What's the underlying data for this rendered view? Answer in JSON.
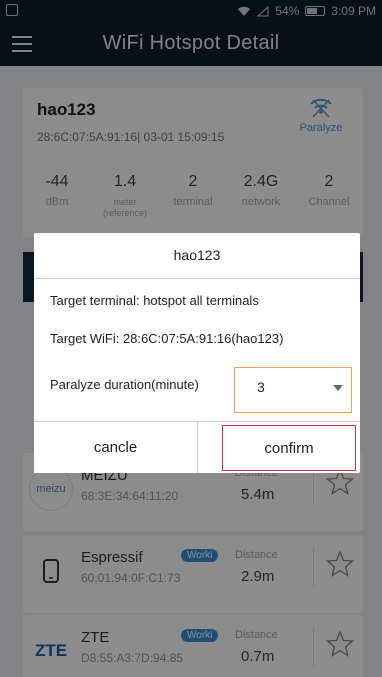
{
  "status_bar": {
    "battery": "54%",
    "time": "3:09 PM"
  },
  "app_bar": {
    "title": "WiFi Hotspot Detail"
  },
  "hotspot": {
    "ssid": "hao123",
    "meta": "28:6C:07:5A:91:16| 03-01 15:09:15",
    "paralyze_label": "Paralyze",
    "stats": [
      {
        "value": "-44",
        "unit": "dBm"
      },
      {
        "value": "1.4",
        "unit": "meter (reference)"
      },
      {
        "value": "2",
        "unit": "terminal"
      },
      {
        "value": "2.4G",
        "unit": "network"
      },
      {
        "value": "2",
        "unit": "Channel"
      }
    ]
  },
  "devices": [
    {
      "brand": "meizu",
      "name": "MEIZU",
      "mac": "68:3E:34:64:11:20",
      "badge": "",
      "distance_label": "Distance",
      "distance": "5.4m"
    },
    {
      "brand": "phone",
      "name": "Espressif",
      "mac": "60:01:94:0F:C1:73",
      "badge": "Worki",
      "distance_label": "Distance",
      "distance": "2.9m"
    },
    {
      "brand": "ZTE",
      "name": "ZTE",
      "mac": "D8:55:A3:7D:94:85",
      "badge": "Worki",
      "distance_label": "Distance",
      "distance": "0.7m"
    }
  ],
  "dialog": {
    "title": "hao123",
    "target_terminal": "Target terminal: hotspot all terminals",
    "target_wifi": "Target WiFi:  28:6C:07:5A:91:16(hao123)",
    "duration_label": "Paralyze duration(minute)",
    "duration_value": "3",
    "cancel_label": "cancle",
    "confirm_label": "confirm"
  },
  "colors": {
    "header_bg": "#0d1e2d",
    "accent": "#4a9bd6",
    "confirm_border": "#dd3333",
    "select_border": "#f2a15a"
  }
}
